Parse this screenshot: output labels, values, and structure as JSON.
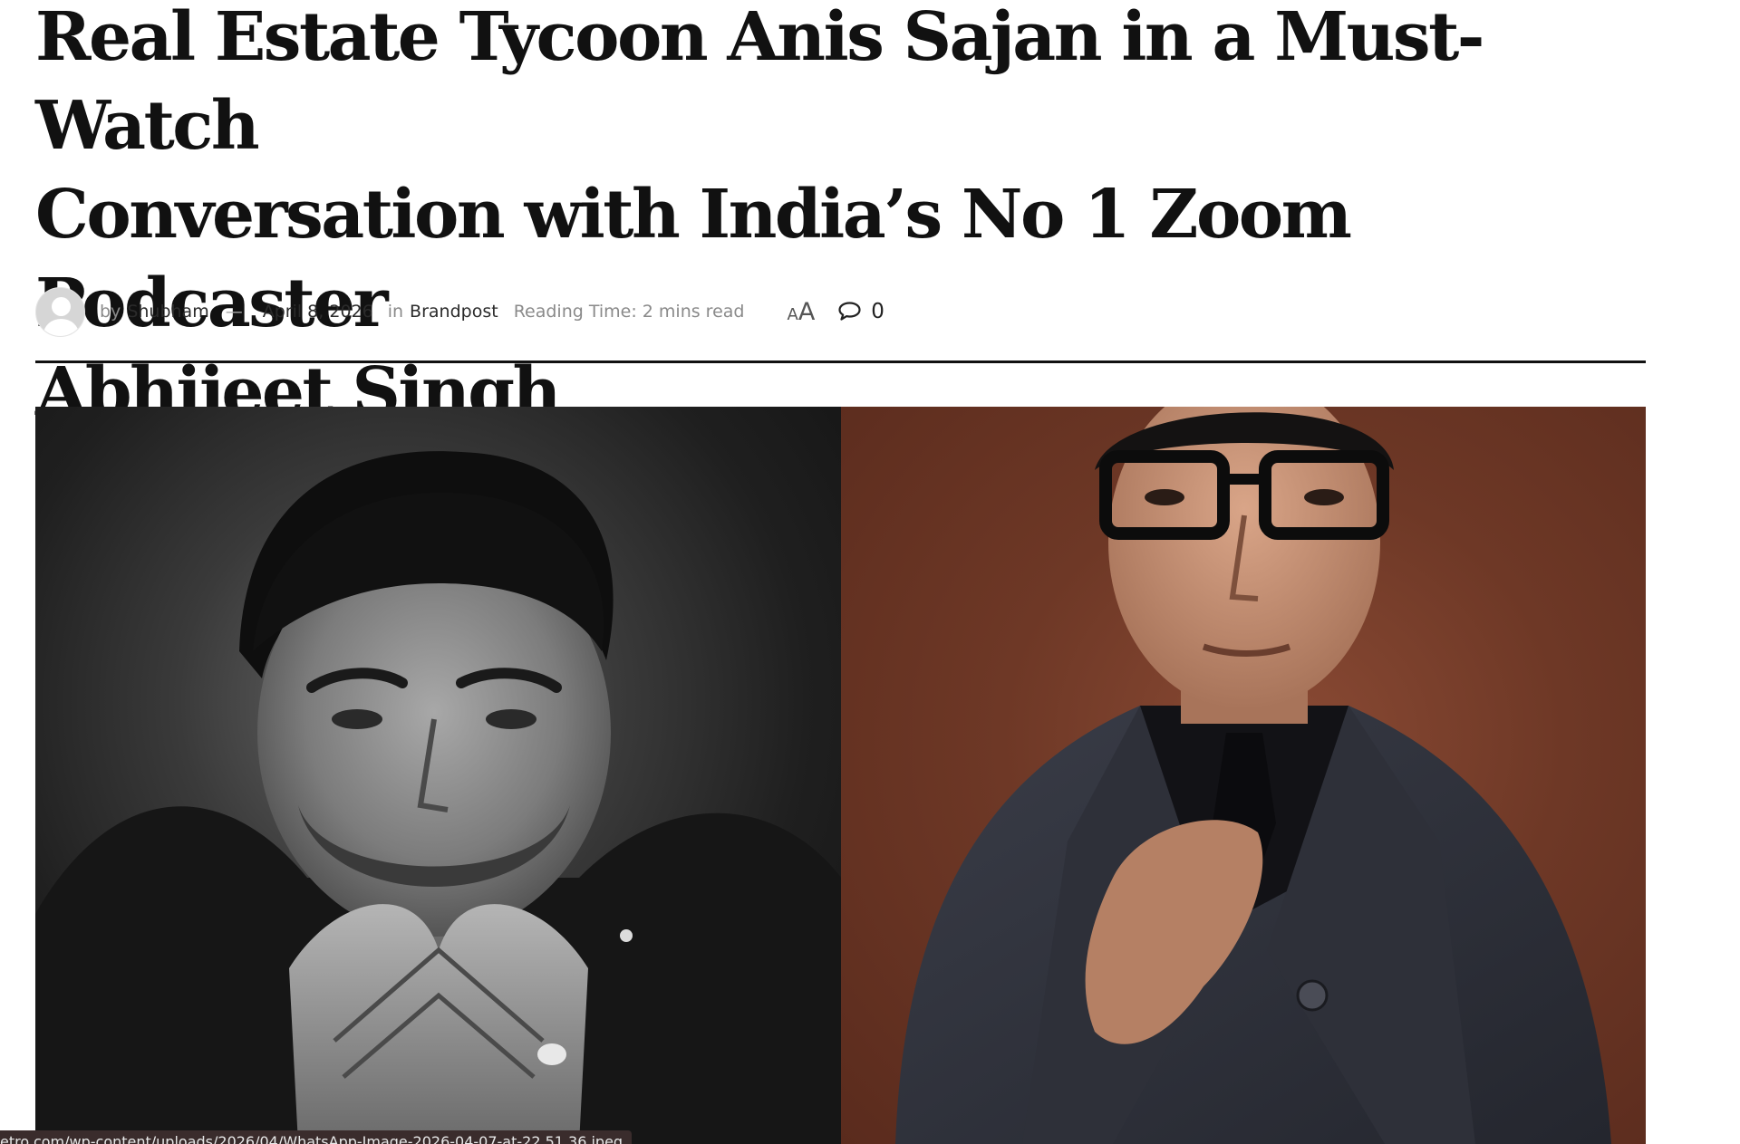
{
  "article": {
    "title_lines": [
      "Real Estate Tycoon Anis Sajan in a Must-Watch",
      "Conversation with India’s No 1 Zoom Podcaster",
      "Abhijeet Singh"
    ],
    "meta": {
      "by_label": "by",
      "author": "Shubham",
      "separator": "—",
      "date": "April 8, 2026",
      "in_label": "in",
      "category": "Brandpost",
      "reading_time": "Reading Time: 2 mins read",
      "font_toggle_small": "A",
      "font_toggle_large": "A",
      "comment_count": "0"
    }
  },
  "status_bar": {
    "url": "etro.com/wp-content/uploads/2026/04/WhatsApp-Image-2026-04-07-at-22.51.36.jpeg"
  },
  "icons": {
    "avatar": "user-avatar-icon",
    "comments": "comment-bubble-icon",
    "font_size": "font-size-icon"
  },
  "colors": {
    "text": "#111111",
    "muted": "#8a8a8a",
    "divider": "#111111",
    "photo_left_bg": "#1f1f1f",
    "photo_right_bg": "#6e3826"
  }
}
